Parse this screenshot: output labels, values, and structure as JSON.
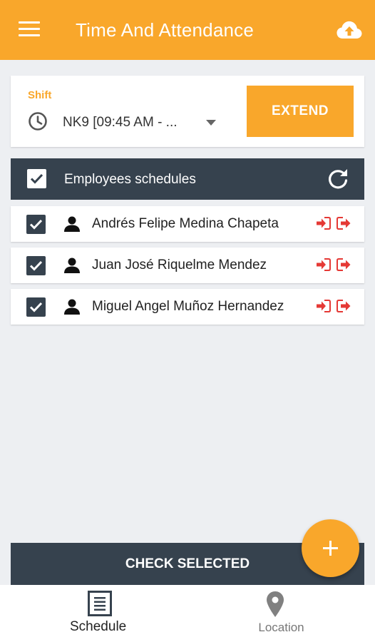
{
  "appbar": {
    "title": "Time And Attendance",
    "menu_icon": "hamburger-menu-icon",
    "upload_icon": "cloud-upload-icon",
    "color": "#f9a72b"
  },
  "shift": {
    "label": "Shift",
    "value": "NK9 [09:45 AM - ...",
    "extend_label": "EXTEND"
  },
  "schedules": {
    "title": "Employees schedules",
    "all_checked": true,
    "header_color": "#36424e",
    "employees": [
      {
        "name": "Andrés Felipe Medina Chapeta",
        "checked": true
      },
      {
        "name": "Juan José Riquelme Mendez",
        "checked": true
      },
      {
        "name": "Miguel Angel Muñoz Hernandez",
        "checked": true
      }
    ],
    "signin_color": "#e53935"
  },
  "actions": {
    "check_selected_label": "CHECK SELECTED",
    "fab_icon": "plus-icon"
  },
  "bottom_nav": {
    "items": [
      {
        "label": "Schedule",
        "icon": "schedule-icon",
        "active": true
      },
      {
        "label": "Location",
        "icon": "location-pin-icon",
        "active": false
      }
    ]
  }
}
